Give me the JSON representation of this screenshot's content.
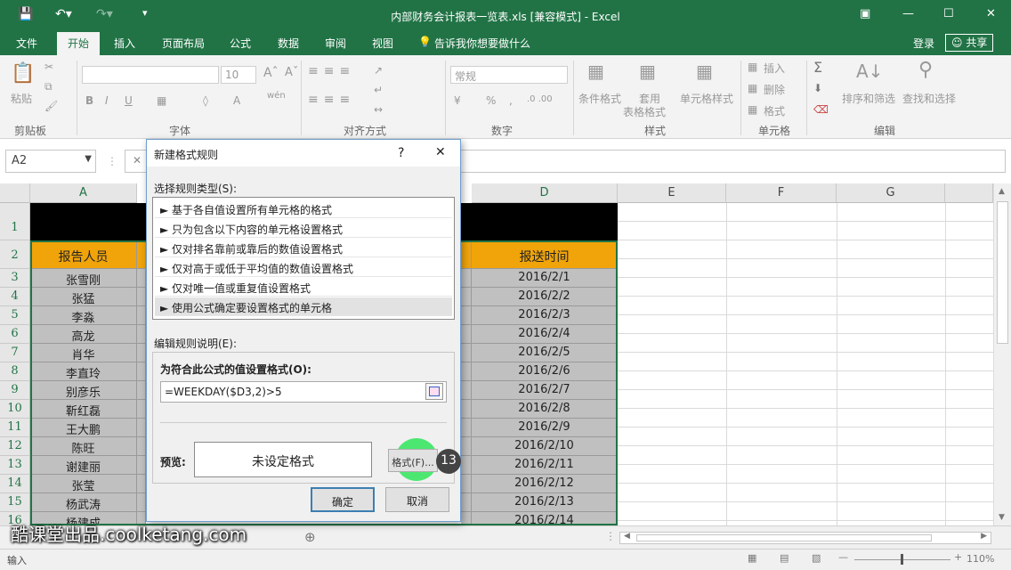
{
  "titlebar": {
    "title": "内部财务会计报表一览表.xls  [兼容模式] - Excel"
  },
  "tabs": [
    "文件",
    "开始",
    "插入",
    "页面布局",
    "公式",
    "数据",
    "审阅",
    "视图"
  ],
  "tell_me": "告诉我你想要做什么",
  "login": "登录",
  "share": "共享",
  "ribbon": {
    "paste": "粘贴",
    "clipboard": "剪贴板",
    "font_group": "字体",
    "font_size": "10",
    "align_group": "对齐方式",
    "number_format": "常规",
    "number_group": "数字",
    "cond_format": "条件格式",
    "table_format_1": "套用",
    "table_format_2": "表格格式",
    "cell_style": "单元格样式",
    "style_group": "样式",
    "insert": "插入",
    "delete": "删除",
    "format": "格式",
    "cells_group": "单元格",
    "sort_filter": "排序和筛选",
    "find_select": "查找和选择",
    "edit_group": "编辑"
  },
  "namebox": "A2",
  "grid": {
    "cols": [
      "A",
      "D",
      "E",
      "F",
      "G"
    ],
    "rows": [
      "1",
      "2",
      "3",
      "4",
      "5",
      "6",
      "7",
      "8",
      "9",
      "10",
      "11",
      "12",
      "13",
      "14",
      "15",
      "16"
    ],
    "header_a": "报告人员",
    "header_d": "报送时间",
    "names": [
      "张雪刚",
      "张猛",
      "李淼",
      "高龙",
      "肖华",
      "李直玲",
      "别彦乐",
      "靳红磊",
      "王大鹏",
      "陈旺",
      "谢建丽",
      "张莹",
      "杨武涛",
      "杨建成"
    ],
    "dates": [
      "2016/2/1",
      "2016/2/2",
      "2016/2/3",
      "2016/2/4",
      "2016/2/5",
      "2016/2/6",
      "2016/2/7",
      "2016/2/8",
      "2016/2/9",
      "2016/2/10",
      "2016/2/11",
      "2016/2/12",
      "2016/2/13",
      "2016/2/14"
    ]
  },
  "dialog": {
    "title": "新建格式规则",
    "help": "?",
    "select_label": "选择规则类型(S):",
    "rules": [
      "基于各自值设置所有单元格的格式",
      "只为包含以下内容的单元格设置格式",
      "仅对排名靠前或靠后的数值设置格式",
      "仅对高于或低于平均值的数值设置格式",
      "仅对唯一值或重复值设置格式",
      "使用公式确定要设置格式的单元格"
    ],
    "edit_label": "编辑规则说明(E):",
    "formula_label": "为符合此公式的值设置格式(O):",
    "formula": "=WEEKDAY($D3,2)>5",
    "preview_label": "预览:",
    "preview_text": "未设定格式",
    "format_btn": "格式(F)...",
    "ok": "确定",
    "cancel": "取消"
  },
  "step_badge": "13",
  "status": {
    "mode": "输入",
    "zoom": "110%"
  },
  "watermark": "酷课堂出品.coolketang.com",
  "colors": {
    "excel_green": "#217346",
    "header_orange": "#f0a40a",
    "cell_gray": "#c0c0c0",
    "highlight": "#2fe55a"
  }
}
